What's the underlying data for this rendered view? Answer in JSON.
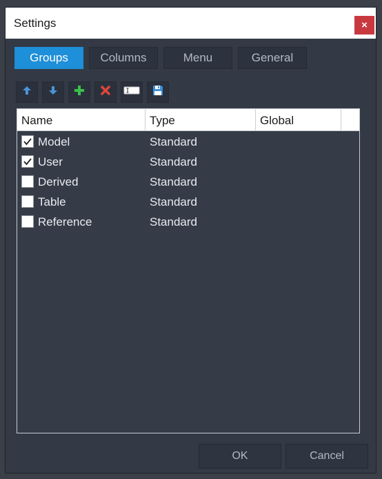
{
  "window": {
    "title": "Settings",
    "close_label": "×"
  },
  "tabs": [
    {
      "label": "Groups",
      "active": true
    },
    {
      "label": "Columns",
      "active": false
    },
    {
      "label": "Menu",
      "active": false
    },
    {
      "label": "General",
      "active": false
    }
  ],
  "toolbar": {
    "buttons": [
      {
        "icon": "arrow-up-icon"
      },
      {
        "icon": "arrow-down-icon"
      },
      {
        "icon": "add-icon"
      },
      {
        "icon": "delete-icon"
      },
      {
        "icon": "rename-icon"
      },
      {
        "icon": "save-icon"
      }
    ]
  },
  "grid": {
    "columns": [
      "Name",
      "Type",
      "Global"
    ],
    "rows": [
      {
        "name": "Model",
        "type": "Standard",
        "checked": true
      },
      {
        "name": "User",
        "type": "Standard",
        "checked": true
      },
      {
        "name": "Derived",
        "type": "Standard",
        "checked": false
      },
      {
        "name": "Table",
        "type": "Standard",
        "checked": false
      },
      {
        "name": "Reference",
        "type": "Standard",
        "checked": false
      }
    ]
  },
  "footer": {
    "ok_label": "OK",
    "cancel_label": "Cancel"
  },
  "colors": {
    "accent": "#1e8fd9",
    "close": "#c8393f",
    "background": "#333a46",
    "add_green": "#39c14a",
    "delete_red": "#e0453a",
    "arrow_blue": "#4a95d8"
  }
}
